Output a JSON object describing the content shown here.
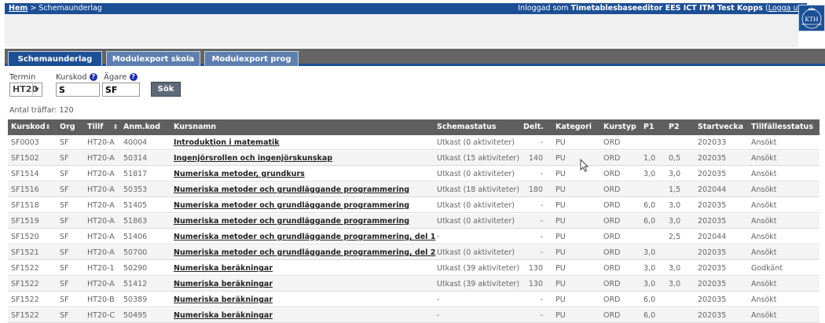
{
  "breadcrumb": {
    "home": "Hem",
    "separator": " > ",
    "current": "Schemaunderlag"
  },
  "login": {
    "prefix": "Inloggad som ",
    "user": "Timetablesbaseeditor EES ICT ITM Test Kopps",
    "open": " (",
    "logout": "Logga ut",
    "close": ")"
  },
  "logo": {
    "text": "KTH",
    "subtext": "VETENSKAP OCH KONST"
  },
  "tabs": [
    {
      "label": "Schemaunderlag",
      "active": true
    },
    {
      "label": "Modulexport skola",
      "active": false
    },
    {
      "label": "Modulexport prog",
      "active": false
    }
  ],
  "filters": {
    "termin": {
      "label": "Termin",
      "value": "HT20"
    },
    "kurskod": {
      "label": "Kurskod",
      "value": "S"
    },
    "agare": {
      "label": "Ägare",
      "value": "SF"
    },
    "search_button": "Sök"
  },
  "hits": "Antal träffar: 120",
  "table": {
    "columns": [
      "Kurskod",
      "Org",
      "Tillf",
      "Anm.kod",
      "Kursnamn",
      "Schemastatus",
      "Delt.",
      "Kategori",
      "Kurstyp",
      "P1",
      "P2",
      "Startvecka",
      "Tillfällesstatus"
    ],
    "sort_marker": "⇕",
    "rows": [
      [
        "SF0003",
        "SF",
        "HT20-A",
        "40004",
        "Introduktion i matematik",
        "Utkast (0 aktiviteter)",
        "-",
        "PU",
        "ORD",
        "",
        "",
        "202033",
        "Ansökt"
      ],
      [
        "SF1502",
        "SF",
        "HT20-A",
        "50314",
        "Ingenjörsrollen och ingenjörskunskap",
        "Utkast (15 aktiviteter)",
        "140",
        "PU",
        "ORD",
        "1,0",
        "0,5",
        "202035",
        "Ansökt"
      ],
      [
        "SF1514",
        "SF",
        "HT20-A",
        "51817",
        "Numeriska metoder, grundkurs",
        "Utkast (0 aktiviteter)",
        "-",
        "PU",
        "ORD",
        "3,0",
        "3,0",
        "202035",
        "Ansökt"
      ],
      [
        "SF1516",
        "SF",
        "HT20-A",
        "50353",
        "Numeriska metoder och grundläggande programmering",
        "Utkast (18 aktiviteter)",
        "180",
        "PU",
        "ORD",
        "",
        "1,5",
        "202044",
        "Ansökt"
      ],
      [
        "SF1518",
        "SF",
        "HT20-A",
        "51405",
        "Numeriska metoder och grundläggande programmering",
        "Utkast (0 aktiviteter)",
        "-",
        "PU",
        "ORD",
        "6,0",
        "3,0",
        "202035",
        "Ansökt"
      ],
      [
        "SF1519",
        "SF",
        "HT20-A",
        "51863",
        "Numeriska metoder och grundläggande programmering",
        "Utkast (0 aktiviteter)",
        "-",
        "PU",
        "ORD",
        "6,0",
        "3,0",
        "202035",
        "Ansökt"
      ],
      [
        "SF1520",
        "SF",
        "HT20-A",
        "51406",
        "Numeriska metoder och grundläggande programmering, del 1",
        "-",
        "-",
        "PU",
        "ORD",
        "",
        "2,5",
        "202044",
        "Ansökt"
      ],
      [
        "SF1521",
        "SF",
        "HT20-A",
        "50700",
        "Numeriska metoder och grundläggande programmering, del 2",
        "Utkast (0 aktiviteter)",
        "-",
        "PU",
        "ORD",
        "3,0",
        "",
        "202035",
        "Ansökt"
      ],
      [
        "SF1522",
        "SF",
        "HT20-1",
        "50290",
        "Numeriska beräkningar",
        "Utkast (39 aktiviteter)",
        "130",
        "PU",
        "ORD",
        "3,0",
        "3,0",
        "202035",
        "Godkänt"
      ],
      [
        "SF1522",
        "SF",
        "HT20-A",
        "51412",
        "Numeriska beräkningar",
        "Utkast (39 aktiviteter)",
        "130",
        "PU",
        "ORD",
        "3,0",
        "3,0",
        "202035",
        "Ansökt"
      ],
      [
        "SF1522",
        "SF",
        "HT20-B",
        "50389",
        "Numeriska beräkningar",
        "-",
        "-",
        "PU",
        "ORD",
        "6,0",
        "",
        "202035",
        "Ansökt"
      ],
      [
        "SF1522",
        "SF",
        "HT20-C",
        "50495",
        "Numeriska beräkningar",
        "-",
        "-",
        "PU",
        "ORD",
        "6,0",
        "",
        "202035",
        "Ansökt"
      ]
    ]
  }
}
